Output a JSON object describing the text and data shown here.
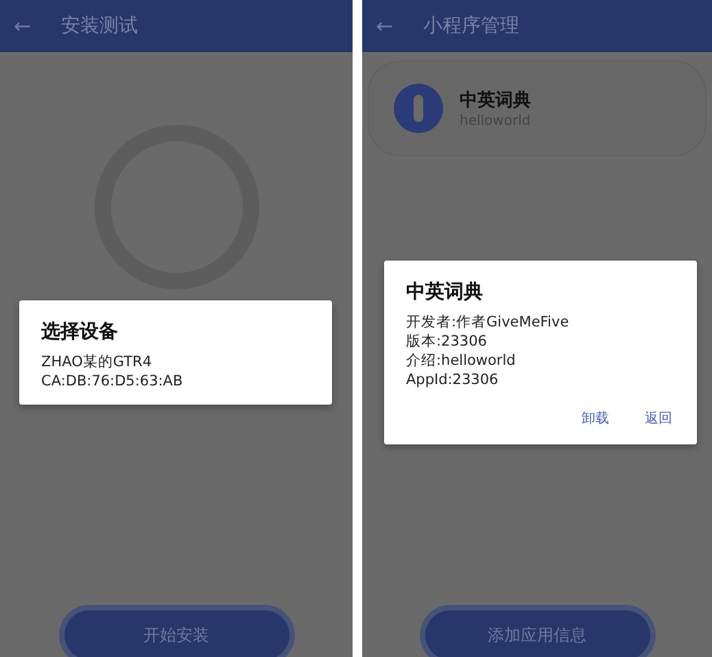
{
  "screens": [
    {
      "kind": "install",
      "header": {
        "back": "←",
        "title": "安装测试"
      },
      "dialog": {
        "title": "选择设备",
        "lines": [
          "ZHAO某的GTR4",
          "CA:DB:76:D5:63:AB"
        ]
      },
      "button": "开始安装"
    },
    {
      "kind": "manage",
      "header": {
        "back": "←",
        "title": "小程序管理"
      },
      "app_card": {
        "name": "中英词典",
        "subtitle": "helloworld"
      },
      "dialog": {
        "title": "中英词典",
        "lines": [
          "开发者:作者GiveMeFive",
          "版本:23306",
          "介绍:helloworld",
          "AppId:23306"
        ],
        "actions": [
          "卸载",
          "返回"
        ]
      },
      "button": "添加应用信息"
    }
  ]
}
